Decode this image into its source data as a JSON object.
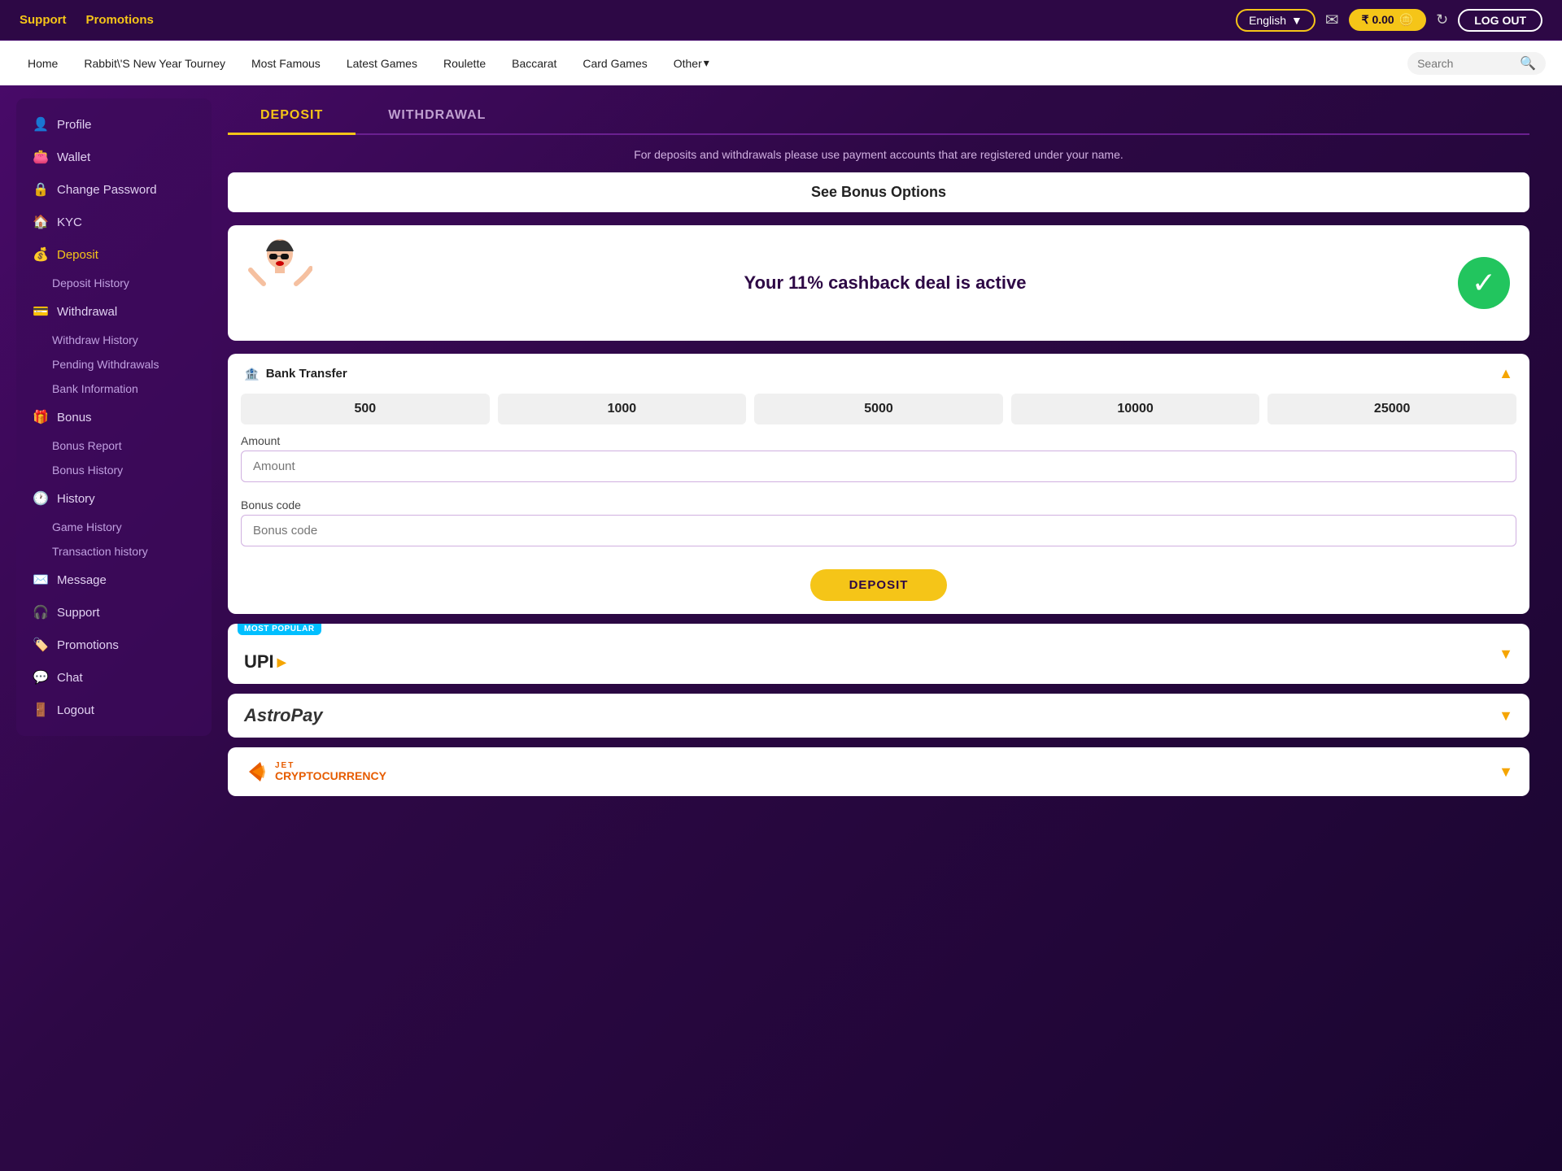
{
  "topbar": {
    "links": [
      "Support",
      "Promotions"
    ],
    "language": "English",
    "wallet": "₹ 0.00",
    "logout": "LOG OUT"
  },
  "navbar": {
    "items": [
      "Home",
      "Rabbit\\'S New Year Tourney",
      "Most Famous",
      "Latest Games",
      "Roulette",
      "Baccarat",
      "Card Games",
      "Other"
    ],
    "search_placeholder": "Search"
  },
  "sidebar": {
    "items": [
      {
        "icon": "👤",
        "label": "Profile"
      },
      {
        "icon": "👛",
        "label": "Wallet"
      },
      {
        "icon": "🔒",
        "label": "Change Password"
      },
      {
        "icon": "🏠",
        "label": "KYC"
      },
      {
        "icon": "💰",
        "label": "Deposit",
        "active": true
      },
      {
        "icon": "",
        "label": "Deposit History",
        "sub": true
      },
      {
        "icon": "💳",
        "label": "Withdrawal"
      },
      {
        "icon": "",
        "label": "Withdraw History",
        "sub": true
      },
      {
        "icon": "",
        "label": "Pending Withdrawals",
        "sub": true
      },
      {
        "icon": "",
        "label": "Bank Information",
        "sub": true
      },
      {
        "icon": "🎁",
        "label": "Bonus"
      },
      {
        "icon": "",
        "label": "Bonus Report",
        "sub": true
      },
      {
        "icon": "",
        "label": "Bonus History",
        "sub": true
      },
      {
        "icon": "🕐",
        "label": "History"
      },
      {
        "icon": "",
        "label": "Game History",
        "sub": true
      },
      {
        "icon": "",
        "label": "Transaction history",
        "sub": true
      },
      {
        "icon": "✉️",
        "label": "Message"
      },
      {
        "icon": "🎧",
        "label": "Support"
      },
      {
        "icon": "🏷️",
        "label": "Promotions"
      },
      {
        "icon": "💬",
        "label": "Chat"
      },
      {
        "icon": "🚪",
        "label": "Logout"
      }
    ]
  },
  "content": {
    "tabs": [
      "DEPOSIT",
      "WITHDRAWAL"
    ],
    "active_tab": "DEPOSIT",
    "info_text": "For deposits and withdrawals please use payment accounts that are registered under your name.",
    "bonus_options_label": "See Bonus Options",
    "cashback": {
      "text": "Your 11% cashback deal is active"
    },
    "bank_transfer": {
      "label": "Bank Transfer",
      "amounts": [
        "500",
        "1000",
        "5000",
        "10000",
        "25000"
      ],
      "amount_label": "Amount",
      "amount_placeholder": "Amount",
      "bonus_code_label": "Bonus code",
      "bonus_code_placeholder": "Bonus code",
      "deposit_btn": "DEPOSIT"
    },
    "payment_methods": [
      {
        "name": "UPI",
        "badge": "MOST POPULAR"
      },
      {
        "name": "AstroPay",
        "badge": ""
      },
      {
        "name": "JET CRYPTOCURRENCY",
        "badge": ""
      }
    ]
  }
}
